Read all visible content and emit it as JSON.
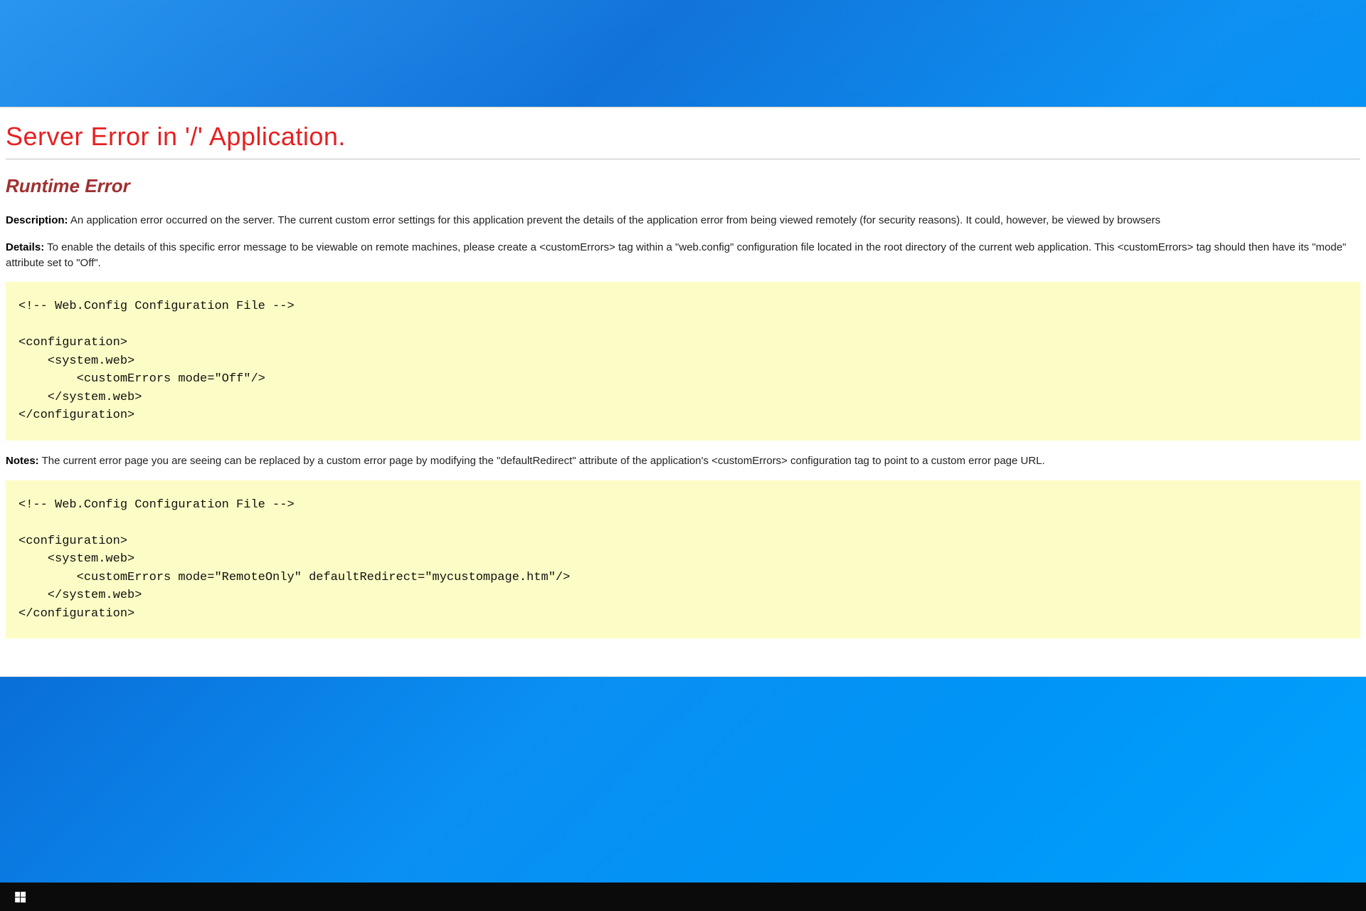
{
  "page": {
    "title": "Server Error in '/' Application.",
    "subtitle": "Runtime Error",
    "description_label": "Description:",
    "description_text": "An application error occurred on the server. The current custom error settings for this application prevent the details of the application error from being viewed remotely (for security reasons). It could, however, be viewed by browsers",
    "details_label": "Details:",
    "details_text": "To enable the details of this specific error message to be viewable on remote machines, please create a <customErrors> tag within a \"web.config\" configuration file located in the root directory of the current web application. This <customErrors> tag should then have its \"mode\" attribute set to \"Off\".",
    "code1": "<!-- Web.Config Configuration File -->\n\n<configuration>\n    <system.web>\n        <customErrors mode=\"Off\"/>\n    </system.web>\n</configuration>",
    "notes_label": "Notes:",
    "notes_text": "The current error page you are seeing can be replaced by a custom error page by modifying the \"defaultRedirect\" attribute of the application's <customErrors> configuration tag to point to a custom error page URL.",
    "code2": "<!-- Web.Config Configuration File -->\n\n<configuration>\n    <system.web>\n        <customErrors mode=\"RemoteOnly\" defaultRedirect=\"mycustompage.htm\"/>\n    </system.web>\n</configuration>"
  },
  "taskbar": {
    "start": "Start"
  }
}
